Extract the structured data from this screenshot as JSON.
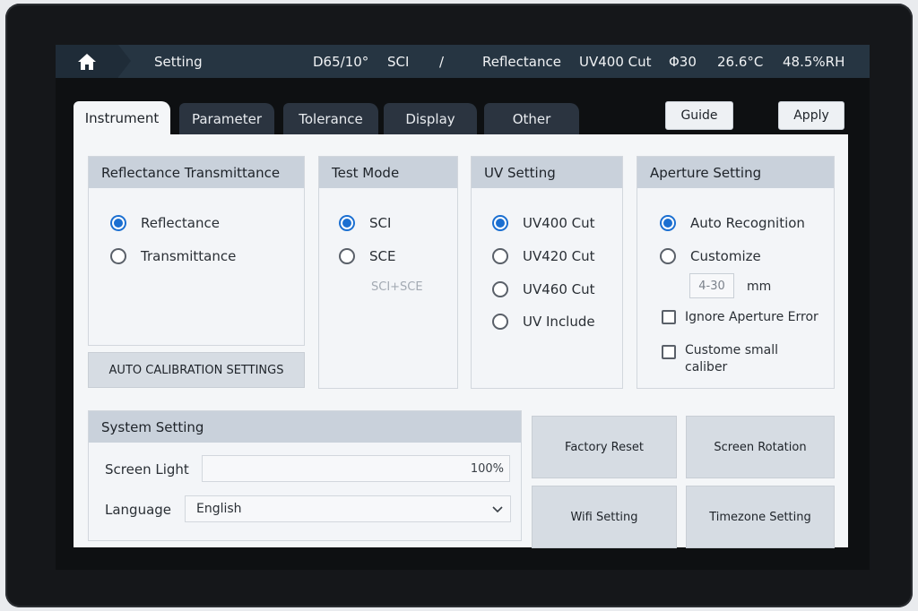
{
  "status_bar": {
    "title": "Setting",
    "illuminant": "D65/10°",
    "specular": "SCI",
    "separator": "/",
    "mode": "Reflectance",
    "uv": "UV400 Cut",
    "aperture": "Φ30",
    "temperature": "26.6°C",
    "humidity": "48.5%RH",
    "home_icon": "home-icon"
  },
  "tabs": [
    {
      "label": "Instrument",
      "active": true
    },
    {
      "label": "Parameter",
      "active": false
    },
    {
      "label": "Tolerance",
      "active": false
    },
    {
      "label": "Display",
      "active": false
    },
    {
      "label": "Other",
      "active": false
    }
  ],
  "buttons": {
    "guide": "Guide",
    "apply": "Apply",
    "auto_calibration": "AUTO CALIBRATION SETTINGS",
    "factory_reset": "Factory Reset",
    "screen_rotation": "Screen Rotation",
    "wifi_setting": "Wifi Setting",
    "timezone_setting": "Timezone Setting"
  },
  "reflectance_box": {
    "title": "Reflectance Transmittance",
    "options": [
      {
        "label": "Reflectance",
        "selected": true
      },
      {
        "label": "Transmittance",
        "selected": false
      }
    ]
  },
  "test_mode_box": {
    "title": "Test Mode",
    "options": [
      {
        "label": "SCI",
        "selected": true
      },
      {
        "label": "SCE",
        "selected": false
      }
    ],
    "disabled_option": "SCI+SCE"
  },
  "uv_box": {
    "title": "UV Setting",
    "options": [
      {
        "label": "UV400 Cut",
        "selected": true
      },
      {
        "label": "UV420 Cut",
        "selected": false
      },
      {
        "label": "UV460 Cut",
        "selected": false
      },
      {
        "label": "UV Include",
        "selected": false
      }
    ]
  },
  "aperture_box": {
    "title": "Aperture Setting",
    "options": [
      {
        "label": "Auto Recognition",
        "selected": true
      },
      {
        "label": "Customize",
        "selected": false
      }
    ],
    "custom_placeholder": "4-30",
    "unit": "mm",
    "ignore_error": "Ignore Aperture Error",
    "custom_small_line1": "Custome small",
    "custom_small_line2": "caliber"
  },
  "system_box": {
    "title": "System Setting",
    "screen_light_label": "Screen Light",
    "screen_light_value": "100%",
    "language_label": "Language",
    "language_value": "English"
  },
  "colors": {
    "accent": "#1b6fd1",
    "status_bar": "#263542",
    "tab_inactive": "#2b3440",
    "section_header": "#c9d1db"
  }
}
